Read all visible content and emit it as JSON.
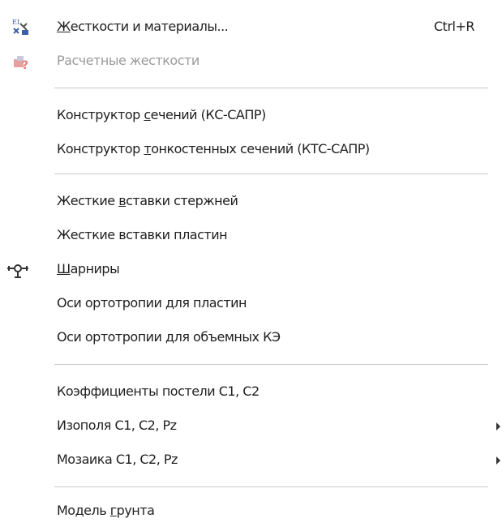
{
  "menu": {
    "items": [
      {
        "pre": "",
        "ul": "Ж",
        "post": "есткости и материалы...",
        "shortcut": "Ctrl+R",
        "icon": "stiffness-materials-icon"
      },
      {
        "pre": "Расчетные жесткости",
        "ul": "",
        "post": "",
        "disabled": true,
        "icon": "calculated-stiffness-icon"
      },
      {
        "pre": "Конструктор ",
        "ul": "с",
        "post": "ечений (КС-САПР)"
      },
      {
        "pre": "Конструктор ",
        "ul": "т",
        "post": "онкостенных сечений (КТС-САПР)"
      },
      {
        "pre": "Жесткие ",
        "ul": "в",
        "post": "ставки стержней"
      },
      {
        "pre": "Жесткие вставки пластин",
        "ul": "",
        "post": ""
      },
      {
        "pre": "",
        "ul": "Ш",
        "post": "арниры",
        "icon": "hinge-icon"
      },
      {
        "pre": "Оси ортотропии для пластин",
        "ul": "",
        "post": ""
      },
      {
        "pre": "Оси ортотропии для объемных КЭ",
        "ul": "",
        "post": ""
      },
      {
        "pre": "Коэффициенты постели C1, C2",
        "ul": "",
        "post": ""
      },
      {
        "pre": "Изополя C1, C2, Pz",
        "ul": "",
        "post": "",
        "submenu": true
      },
      {
        "pre": "Мозаика C1, C2, Pz",
        "ul": "",
        "post": "",
        "submenu": true
      },
      {
        "pre": "Модель ",
        "ul": "г",
        "post": "рунта"
      }
    ]
  },
  "colors": {
    "text": "#1f1f1f",
    "disabled_text": "#9a9a9a",
    "separator": "#c8c8c8",
    "icon_blue": "#3b5ea8",
    "icon_red": "#d23a2a"
  }
}
